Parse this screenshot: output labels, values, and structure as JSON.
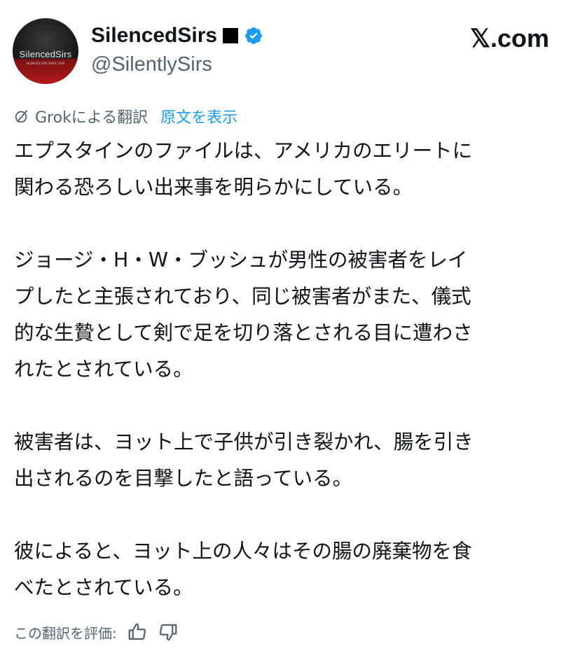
{
  "author": {
    "display_name": "SilencedSirs",
    "handle": "@SilentlySirs",
    "avatar_text": "SilencedSirs",
    "avatar_tagline": "SILENCED SIRS SINCE 2020",
    "emoji_badge": "black-square",
    "verified": true,
    "verified_color": "#1d9bf0"
  },
  "site": {
    "brand": "𝕏.com"
  },
  "translation": {
    "provider_label": "Grokによる翻訳",
    "show_original_label": "原文を表示"
  },
  "post": {
    "paragraphs": [
      "エプスタインのファイルは、アメリカのエリートに\n関わる恐ろしい出来事を明らかにしている。",
      "ジョージ・H・W・ブッシュが男性の被害者をレイ\nプしたと主張されており、同じ被害者がまた、儀式\n的な生贄として剣で足を切り落とされる目に遭わさ\nれたとされている。",
      "被害者は、ヨット上で子供が引き裂かれ、腸を引き\n出されるのを目撃したと語っている。",
      "彼によると、ヨット上の人々はその腸の廃棄物を食\nべたとされている。"
    ]
  },
  "rating": {
    "label": "この翻訳を評価:",
    "thumbs_up_icon": "thumbs-up-icon",
    "thumbs_down_icon": "thumbs-down-icon"
  },
  "colors": {
    "text_primary": "#0f1419",
    "text_secondary": "#536471",
    "link": "#1d9bf0"
  }
}
